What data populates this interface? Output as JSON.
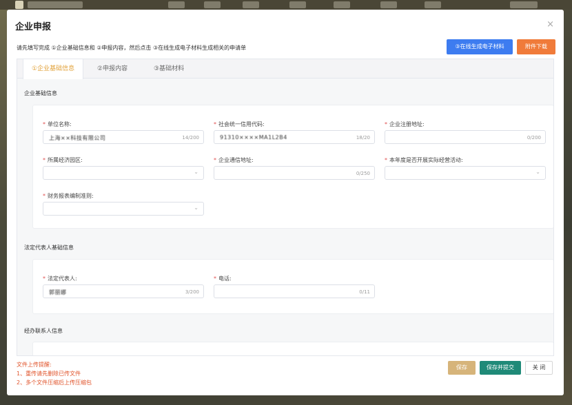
{
  "modal": {
    "title": "企业申报",
    "close_glyph": "×",
    "instruction": "请先填写完成 ①企业基础信息和 ②申报内容，然后点击 ③在线生成电子材料生成相关的申请单",
    "generate_button": "③在线生成电子材料",
    "attachment_button": "附件下载"
  },
  "tabs": [
    "①企业基础信息",
    "②申报内容",
    "③基础材料"
  ],
  "active_tab": 0,
  "sections": {
    "basic": "企业基础信息",
    "legal": "法定代表人基础信息",
    "contact": "经办联系人信息"
  },
  "basic_fields": {
    "unit_name": {
      "label": "单位名称:",
      "value": "上海××科技有限公司",
      "count": "14/200"
    },
    "credit_code": {
      "label": "社会统一信用代码:",
      "value": "91310××××MA1L2B4",
      "count": "18/20"
    },
    "reg_address": {
      "label": "企业注册地址:",
      "value": "",
      "count": "0/200"
    },
    "park": {
      "label": "所属经济园区:",
      "value": ""
    },
    "mail_address": {
      "label": "企业通信地址:",
      "value": "",
      "count": "0/250"
    },
    "activity": {
      "label": "本年度是否开展实际经营活动:",
      "value": ""
    },
    "accounting": {
      "label": "财务报表编制准则:",
      "value": ""
    }
  },
  "legal_fields": {
    "rep": {
      "label": "法定代表人:",
      "value": "郭丽娜",
      "count": "3/200"
    },
    "phone": {
      "label": "电话:",
      "value": "",
      "count": "0/11"
    }
  },
  "footer": {
    "tip_title": "文件上传提醒:",
    "tip_1": "1、重传请先删除已传文件",
    "tip_2": "2、多个文件压缩后上传压缩包",
    "save_button": "保存",
    "submit_button": "保存并提交",
    "close_button": "关 闭"
  },
  "icons": {
    "dropdown": "chevron-down-icon",
    "close": "close-icon"
  },
  "colors": {
    "primary_blue": "#3d7cf0",
    "orange": "#f07b3a",
    "active_tab": "#e2a23a",
    "required": "#e05050",
    "submit_teal": "#1f8a78",
    "save_tan": "#d6b47a"
  }
}
